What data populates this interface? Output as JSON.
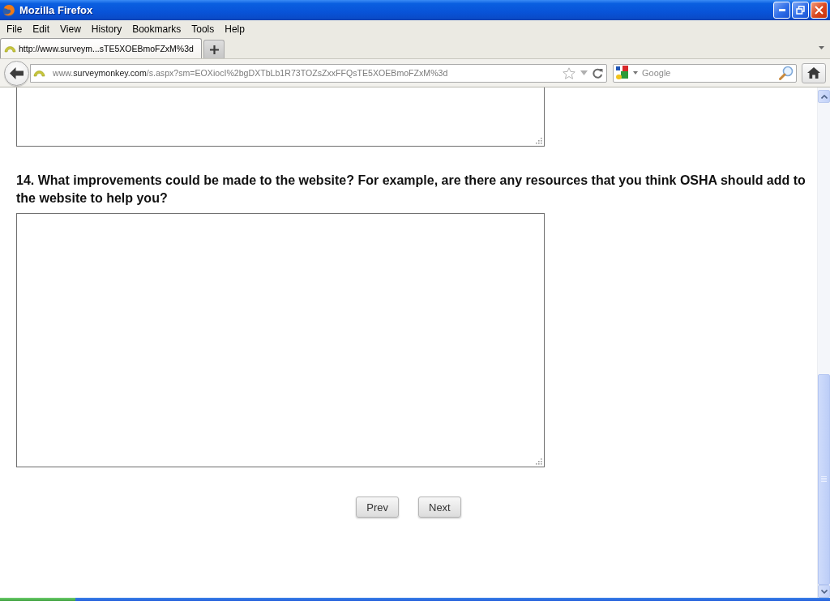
{
  "window": {
    "title": "Mozilla Firefox"
  },
  "menu": [
    "File",
    "Edit",
    "View",
    "History",
    "Bookmarks",
    "Tools",
    "Help"
  ],
  "tabs": [
    {
      "label": "http://www.surveym...sTE5XOEBmoFZxM%3d",
      "selected": true
    }
  ],
  "address_bar": {
    "url": {
      "prefix": "www.",
      "domain": "surveymonkey.com",
      "path": "/s.aspx?sm=EOXiocI%2bgDXTbLb1R73TOZsZxxFFQsTE5XOEBmoFZxM%3d"
    }
  },
  "search": {
    "placeholder": "Google"
  },
  "survey": {
    "items": [
      {
        "kind": "answer_tail"
      },
      {
        "kind": "question",
        "text": "14. What improvements could be made to the website? For example, are there any resources that you think OSHA should add to the website to help you?"
      },
      {
        "kind": "answer_box"
      }
    ],
    "buttons": [
      "Prev",
      "Next"
    ]
  }
}
